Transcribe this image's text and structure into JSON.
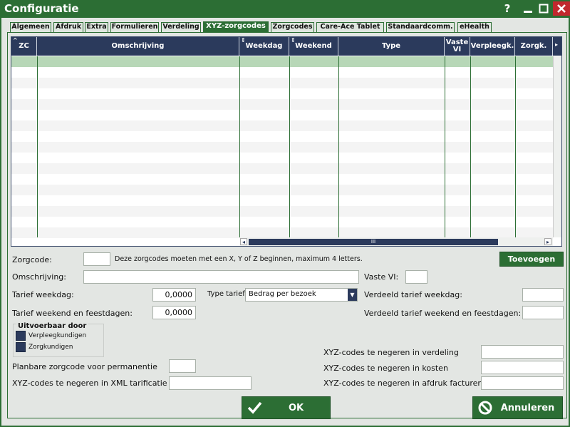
{
  "window": {
    "title": "Configuratie"
  },
  "tabs": [
    {
      "label": "Algemeen"
    },
    {
      "label": "Afdruk"
    },
    {
      "label": "Extra"
    },
    {
      "label": "Formulieren"
    },
    {
      "label": "Verdeling"
    },
    {
      "label": "XYZ-zorgcodes",
      "active": true
    },
    {
      "label": "Zorgcodes"
    },
    {
      "label": "Care-Ace Tablet"
    },
    {
      "label": "Standaardcomm."
    },
    {
      "label": "eHealth"
    }
  ],
  "grid": {
    "columns": [
      "ZC",
      "Omschrijving",
      "Weekdag",
      "Weekend",
      "Type",
      "Vaste VI",
      "Verpleegk.",
      "Zorgk."
    ],
    "rows": []
  },
  "form": {
    "zorgcode_label": "Zorgcode:",
    "zorgcode_value": "",
    "zorgcode_hint": "Deze zorgcodes moeten met een X, Y of Z beginnen, maximum 4 letters.",
    "add_button": "Toevoegen",
    "omschrijving_label": "Omschrijving:",
    "omschrijving_value": "",
    "vaste_vi_label": "Vaste VI:",
    "vaste_vi_value": "",
    "tarief_weekdag_label": "Tarief weekdag:",
    "tarief_weekdag_value": "0,0000",
    "type_tarief_label": "Type tarief",
    "type_tarief_value": "Bedrag per bezoek",
    "verdeeld_weekdag_label": "Verdeeld tarief weekdag:",
    "verdeeld_weekdag_value": "",
    "tarief_weekend_label": "Tarief weekend en feestdagen:",
    "tarief_weekend_value": "0,0000",
    "verdeeld_weekend_label": "Verdeeld tarief weekend en feestdagen:",
    "verdeeld_weekend_value": "",
    "uitvoerbaar_title": "Uitvoerbaar door",
    "verpleegkundigen_label": "Verpleegkundigen",
    "zorgkundigen_label": "Zorgkundigen",
    "planbare_label": "Planbare zorgcode voor permanentie",
    "planbare_value": "",
    "xml_label": "XYZ-codes te negeren in XML tarificatie",
    "xml_value": "",
    "verdeling_label": "XYZ-codes te negeren in verdeling",
    "verdeling_value": "",
    "kosten_label": "XYZ-codes te negeren in kosten",
    "kosten_value": "",
    "afdruk_label": "XYZ-codes te negeren in afdruk facturen",
    "afdruk_value": ""
  },
  "buttons": {
    "ok": "OK",
    "cancel": "Annuleren"
  },
  "icons": {
    "help": "?",
    "scroll_thumb": "III"
  },
  "colors": {
    "accent": "#2c6e34",
    "header": "#2b3a5c",
    "close": "#c1282d",
    "selected_row": "#b7d7b7"
  }
}
